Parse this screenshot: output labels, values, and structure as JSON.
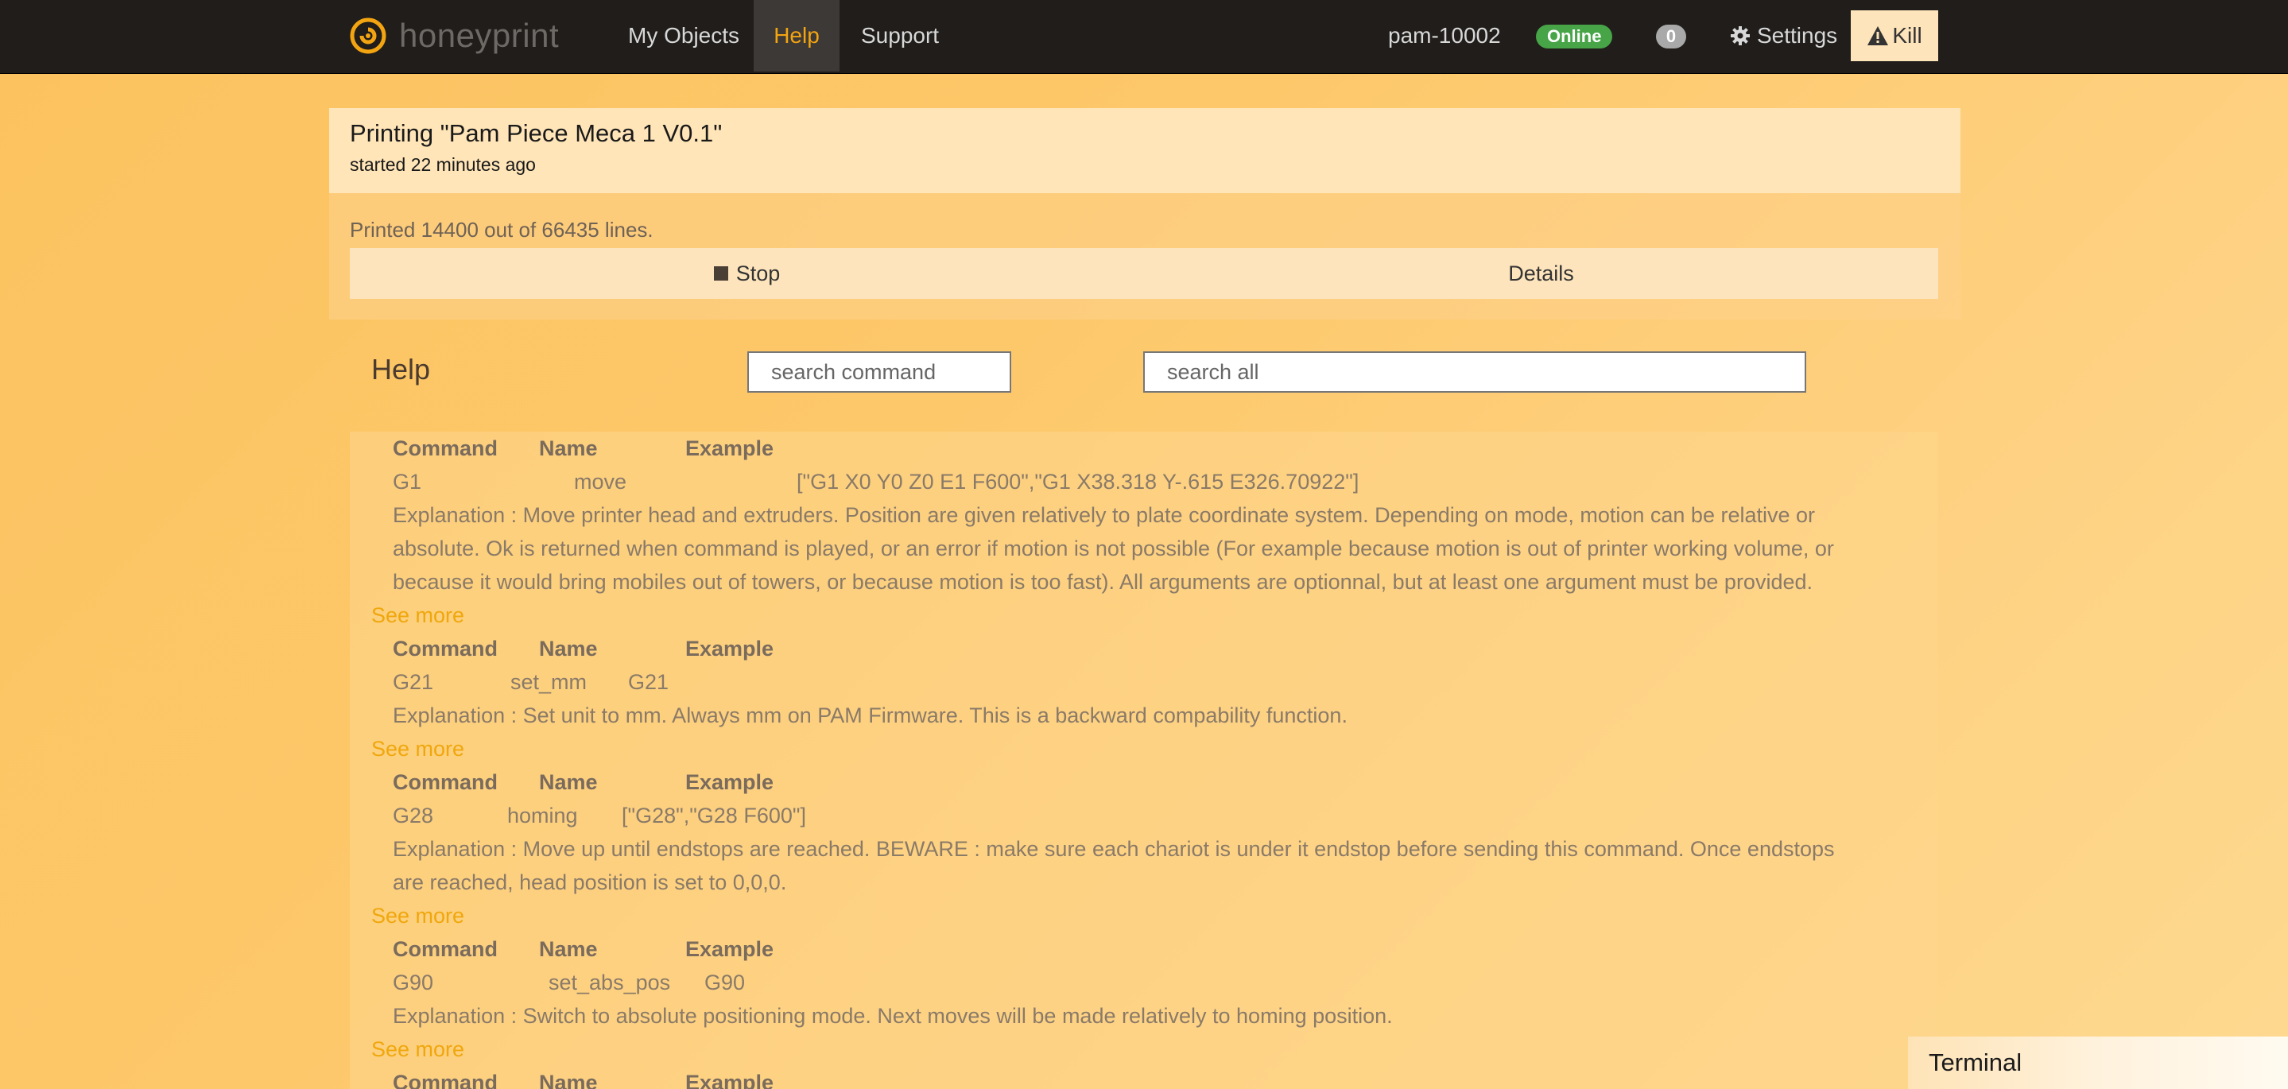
{
  "navbar": {
    "brand": "honeyprint",
    "items": [
      "My Objects",
      "Help",
      "Support"
    ],
    "active": "Help",
    "device": "pam-10002",
    "status": "Online",
    "count": "0",
    "settings": "Settings",
    "kill": "Kill"
  },
  "printing": {
    "title": "Printing \"Pam Piece Meca 1 V0.1\"",
    "started": "started 22 minutes ago",
    "progress_text": "Printed 14400 out of 66435 lines.",
    "printed_lines": 14400,
    "total_lines": 66435,
    "stop_label": "Stop",
    "details_label": "Details"
  },
  "help": {
    "title": "Help",
    "search_command_placeholder": "search command",
    "search_all_placeholder": "search all",
    "col_command": "Command",
    "col_name": "Name",
    "col_example": "Example",
    "see_more": "See more",
    "commands": [
      {
        "command": "G1",
        "name": "move",
        "example": "[\"G1 X0 Y0 Z0 E1 F600\",\"G1 X38.318 Y-.615 E326.70922\"]",
        "explanation": "Explanation : Move printer head and extruders. Position are given relatively to plate coordinate system. Depending on mode, motion can be relative or absolute. Ok is returned when command is played, or an error if motion is not possible (For example because motion is out of printer working volume, or because it would bring mobiles out of towers, or because motion is too fast). All arguments are optionnal, but at least one argument must be provided."
      },
      {
        "command": "G21",
        "name": "set_mm",
        "example": "G21",
        "explanation": "Explanation : Set unit to mm. Always mm on PAM Firmware. This is a backward compability function."
      },
      {
        "command": "G28",
        "name": "homing",
        "example": "[\"G28\",\"G28 F600\"]",
        "explanation": "Explanation : Move up until endstops are reached. BEWARE : make sure each chariot is under it endstop before sending this command. Once endstops are reached, head position is set to 0,0,0."
      },
      {
        "command": "G90",
        "name": "set_abs_pos",
        "example": "G90",
        "explanation": "Explanation : Switch to absolute positioning mode. Next moves will be made relatively to homing position."
      }
    ]
  },
  "terminal": {
    "label": "Terminal"
  },
  "colors": {
    "navbar_bg": "#201d1b",
    "accent": "#f3a411",
    "online": "#47a447",
    "see_more": "#f0a70d"
  }
}
